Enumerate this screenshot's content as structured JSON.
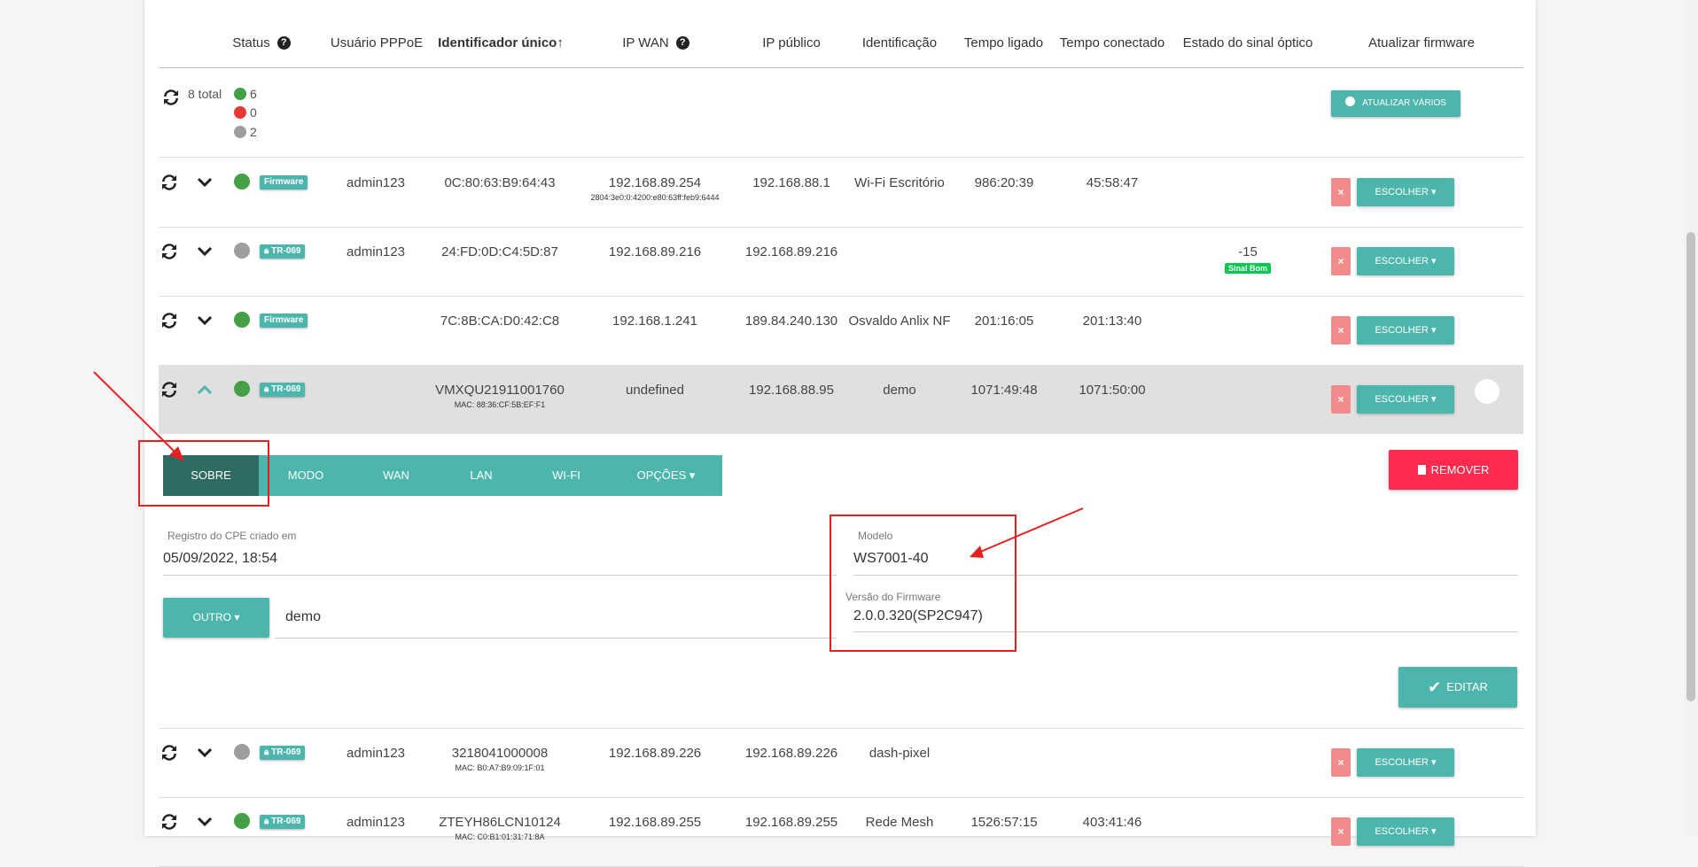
{
  "headers": {
    "status": "Status",
    "pppoe": "Usuário PPPoE",
    "unique_id": "Identificador único↑",
    "ip_wan": "IP WAN",
    "ip_public": "IP público",
    "identification": "Identificação",
    "uptime": "Tempo ligado",
    "connected": "Tempo conectado",
    "optical": "Estado do sinal óptico",
    "firmware": "Atualizar firmware"
  },
  "summary": {
    "total": "8 total",
    "online": "6",
    "offline": "0",
    "unknown": "2",
    "update_many": "ATUALIZAR VÁRIOS"
  },
  "colors": {
    "teal": "#4db6ac",
    "online": "#43a047",
    "offline": "#e53935",
    "unknown": "#9e9e9e",
    "remove": "#ff2a4e",
    "signal_good": "#00c853"
  },
  "rows": [
    {
      "status": "online",
      "badge": "Firmware",
      "locked": false,
      "pppoe": "admin123",
      "id": "0C:80:63:B9:64:43",
      "id_sub": "",
      "ip_wan": "192.168.89.254",
      "ip_wan_sub": "2804:3e0:0:4200:e80:63ff:feb9:6444",
      "ip_public": "192.168.88.1",
      "ident": "Wi-Fi Escritório",
      "uptime": "986:20:39",
      "connected": "45:58:47",
      "signal": "",
      "signal_badge": "",
      "choose": "ESCOLHER ▾",
      "x": "×"
    },
    {
      "status": "unknown",
      "badge": "TR-069",
      "locked": true,
      "pppoe": "admin123",
      "id": "24:FD:0D:C4:5D:87",
      "id_sub": "",
      "ip_wan": "192.168.89.216",
      "ip_wan_sub": "",
      "ip_public": "192.168.89.216",
      "ident": "",
      "uptime": "",
      "connected": "",
      "signal": "-15",
      "signal_badge": "Sinal Bom",
      "choose": "ESCOLHER ▾",
      "x": "×"
    },
    {
      "status": "online",
      "badge": "Firmware",
      "locked": false,
      "pppoe": "",
      "id": "7C:8B:CA:D0:42:C8",
      "id_sub": "",
      "ip_wan": "192.168.1.241",
      "ip_wan_sub": "",
      "ip_public": "189.84.240.130",
      "ident": "Osvaldo Anlix NF",
      "uptime": "201:16:05",
      "connected": "201:13:40",
      "signal": "",
      "signal_badge": "",
      "choose": "ESCOLHER ▾",
      "x": "×"
    },
    {
      "status": "online",
      "badge": "TR-069",
      "locked": true,
      "pppoe": "",
      "id": "VMXQU21911001760",
      "id_sub": "MAC: 88:36:CF:5B:EF:F1",
      "ip_wan": "undefined",
      "ip_wan_sub": "",
      "ip_public": "192.168.88.95",
      "ident": "demo",
      "uptime": "1071:49:48",
      "connected": "1071:50:00",
      "signal": "",
      "signal_badge": "",
      "choose": "ESCOLHER ▾",
      "x": "×"
    },
    {
      "status": "unknown",
      "badge": "TR-069",
      "locked": true,
      "pppoe": "admin123",
      "id": "3218041000008",
      "id_sub": "MAC: B0:A7:B9:09:1F:01",
      "ip_wan": "192.168.89.226",
      "ip_wan_sub": "",
      "ip_public": "192.168.89.226",
      "ident": "dash-pixel",
      "uptime": "",
      "connected": "",
      "signal": "",
      "signal_badge": "",
      "choose": "ESCOLHER ▾",
      "x": "×"
    },
    {
      "status": "online",
      "badge": "TR-069",
      "locked": true,
      "pppoe": "admin123",
      "id": "ZTEYH86LCN10124",
      "id_sub": "MAC: C0:B1:01:31:71:8A",
      "ip_wan": "192.168.89.255",
      "ip_wan_sub": "",
      "ip_public": "192.168.89.255",
      "ident": "Rede Mesh",
      "uptime": "1526:57:15",
      "connected": "403:41:46",
      "signal": "",
      "signal_badge": "",
      "choose": "ESCOLHER ▾",
      "x": "×"
    }
  ],
  "detail": {
    "tabs": [
      "SOBRE",
      "MODO",
      "WAN",
      "LAN",
      "WI-FI",
      "OPÇÕES ▾"
    ],
    "remove": "REMOVER",
    "created_label": "Registro do CPE criado em",
    "created_value": "05/09/2022, 18:54",
    "model_label": "Modelo",
    "model_value": "WS7001-40",
    "fw_label": "Versão do Firmware",
    "fw_value": "2.0.0.320(SP2C947)",
    "other_btn": "OUTRO ▾",
    "other_value": "demo",
    "edit": "EDITAR"
  }
}
